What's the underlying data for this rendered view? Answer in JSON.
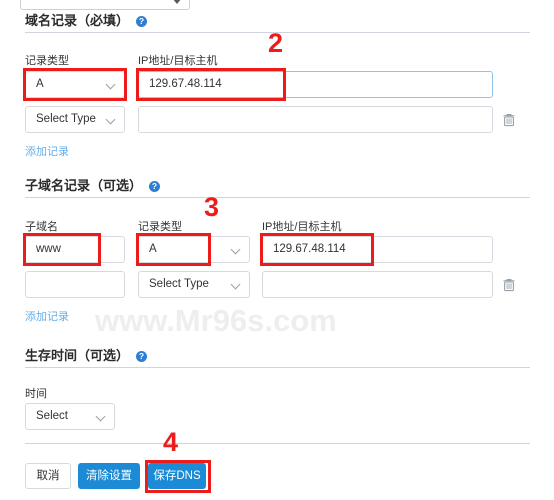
{
  "top_select": {
    "value": "",
    "icon": "chevron-down-icon"
  },
  "watermark": "www.Mr96s.com",
  "sections": {
    "domain_records": {
      "title": "域名记录（必填）",
      "help_icon": "?",
      "columns": {
        "record_type": "记录类型",
        "ip_host": "IP地址/目标主机"
      },
      "rows": [
        {
          "record_type": "A",
          "ip_host": "129.67.48.114"
        },
        {
          "record_type": "Select Type",
          "ip_host": ""
        }
      ],
      "add_link": "添加记录",
      "delete_icon": "trash-icon"
    },
    "subdomain_records": {
      "title": "子域名记录（可选）",
      "help_icon": "?",
      "columns": {
        "subdomain": "子域名",
        "record_type": "记录类型",
        "ip_host": "IP地址/目标主机"
      },
      "rows": [
        {
          "subdomain": "www",
          "record_type": "A",
          "ip_host": "129.67.48.114"
        },
        {
          "subdomain": "",
          "record_type": "Select Type",
          "ip_host": ""
        }
      ],
      "add_link": "添加记录",
      "delete_icon": "trash-icon"
    },
    "ttl": {
      "title": "生存时间（可选）",
      "help_icon": "?",
      "label": "时间",
      "select_value": "Select"
    }
  },
  "footer": {
    "cancel": "取消",
    "clear": "清除设置",
    "save": "保存DNS"
  },
  "annotations": {
    "n2": "2",
    "n3": "3",
    "n4": "4",
    "color": "#ee1b1b"
  }
}
